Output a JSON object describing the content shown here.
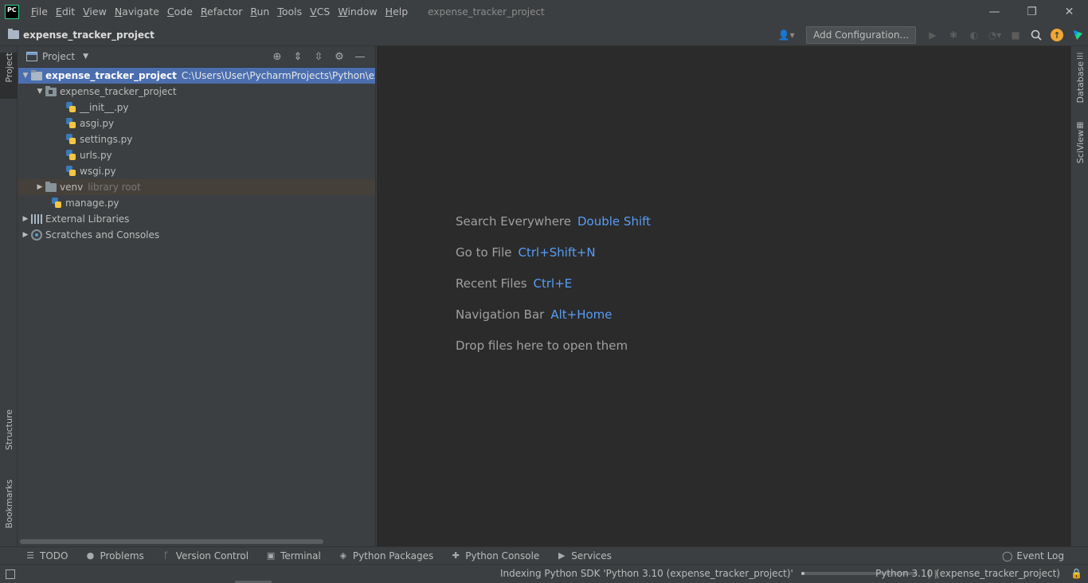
{
  "app": {
    "logo_text": "PC",
    "window_title": "expense_tracker_project"
  },
  "menu": [
    "File",
    "Edit",
    "View",
    "Navigate",
    "Code",
    "Refactor",
    "Run",
    "Tools",
    "VCS",
    "Window",
    "Help"
  ],
  "window_controls": {
    "minimize": "—",
    "restore": "❐",
    "close": "✕"
  },
  "navbar": {
    "project_name": "expense_tracker_project",
    "add_configuration": "Add Configuration...",
    "icons": [
      "user-icon",
      "run-icon",
      "debug-icon",
      "coverage-icon",
      "profile-icon",
      "stop-icon",
      "search-icon",
      "update-icon",
      "jetbrains-toolbox-icon"
    ]
  },
  "left_strip": {
    "project": "Project",
    "structure": "Structure",
    "bookmarks": "Bookmarks"
  },
  "right_strip": {
    "database": "Database",
    "sciview": "SciView"
  },
  "project_panel": {
    "title": "Project",
    "tree": {
      "root_name": "expense_tracker_project",
      "root_path": "C:\\Users\\User\\PycharmProjects\\Python\\expense_t",
      "package_name": "expense_tracker_project",
      "files": [
        "__init__.py",
        "asgi.py",
        "settings.py",
        "urls.py",
        "wsgi.py"
      ],
      "venv_name": "venv",
      "venv_note": "library root",
      "manage": "manage.py",
      "external_libraries": "External Libraries",
      "scratches": "Scratches and Consoles"
    }
  },
  "editor_hints": [
    {
      "label": "Search Everywhere",
      "key": "Double Shift"
    },
    {
      "label": "Go to File",
      "key": "Ctrl+Shift+N"
    },
    {
      "label": "Recent Files",
      "key": "Ctrl+E"
    },
    {
      "label": "Navigation Bar",
      "key": "Alt+Home"
    },
    {
      "label": "Drop files here to open them",
      "key": ""
    }
  ],
  "bottom_tools": {
    "todo": "TODO",
    "problems": "Problems",
    "version_control": "Version Control",
    "terminal": "Terminal",
    "python_packages": "Python Packages",
    "python_console": "Python Console",
    "services": "Services",
    "event_log": "Event Log"
  },
  "status": {
    "indexing": "Indexing Python SDK 'Python 3.10 (expense_tracker_project)'",
    "progress": 0.03,
    "interpreter": "Python 3.10 (expense_tracker_project)"
  },
  "colors": {
    "background": "#3c3f41",
    "editor": "#2b2b2b",
    "selection": "#4b6eaf",
    "shortcut": "#589df6"
  }
}
